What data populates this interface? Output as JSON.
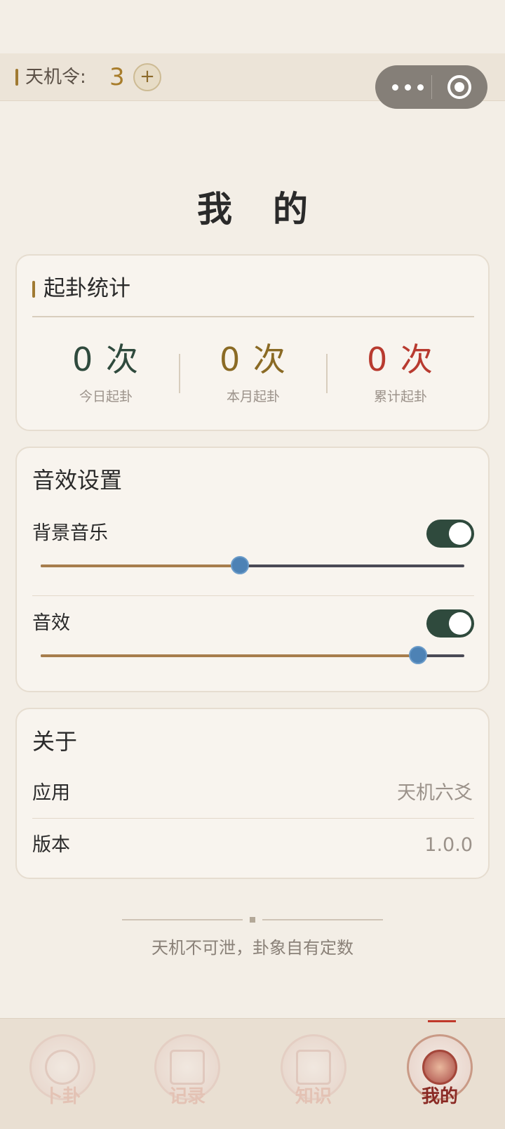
{
  "token_bar": {
    "label": "天机令:",
    "count": "3",
    "add_symbol": "+"
  },
  "page": {
    "title": "我的"
  },
  "stats": {
    "title": "起卦统计",
    "items": [
      {
        "value": "0 次",
        "label": "今日起卦",
        "color": "#2f4a3d"
      },
      {
        "value": "0 次",
        "label": "本月起卦",
        "color": "#8a6a24"
      },
      {
        "value": "0 次",
        "label": "累计起卦",
        "color": "#b83a2f"
      }
    ]
  },
  "audio": {
    "title": "音效设置",
    "bgm": {
      "label": "背景音乐",
      "enabled": true,
      "level": 0.47
    },
    "sfx": {
      "label": "音效",
      "enabled": true,
      "level": 0.89
    }
  },
  "about": {
    "title": "关于",
    "rows": [
      {
        "label": "应用",
        "value": "天机六爻"
      },
      {
        "label": "版本",
        "value": "1.0.0"
      }
    ]
  },
  "footer": {
    "motto": "天机不可泄，卦象自有定数"
  },
  "tabbar": {
    "active": 3,
    "tabs": [
      {
        "label": "卜卦",
        "icon": "bagua-icon"
      },
      {
        "label": "记录",
        "icon": "scroll-icon"
      },
      {
        "label": "知识",
        "icon": "book-icon"
      },
      {
        "label": "我的",
        "icon": "compass-icon"
      }
    ]
  },
  "colors": {
    "accent": "#a07a32",
    "toggle_on": "#2f4a3d",
    "slider_thumb": "#4d82b5"
  }
}
